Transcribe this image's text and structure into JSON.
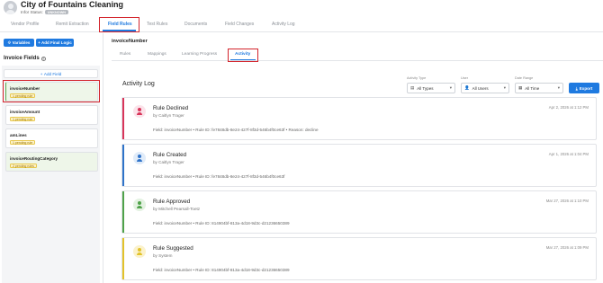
{
  "header": {
    "title": "City of Fountains Cleaning",
    "status_label": "Infor Status:",
    "status_badge": "UNKNOWN"
  },
  "top_tabs": [
    {
      "label": "Vendor Profile"
    },
    {
      "label": "Remit Extraction"
    },
    {
      "label": "Field Rules",
      "active": true
    },
    {
      "label": "Test Rules"
    },
    {
      "label": "Documents"
    },
    {
      "label": "Field Changes"
    },
    {
      "label": "Activity Log"
    }
  ],
  "left_panel": {
    "variables_label": "Variables",
    "add_final_logic_label": "+ Add Final Logic",
    "invoice_fields_label": "Invoice Fields",
    "help_glyph": "?",
    "add_field_label": "Add Field",
    "fields": [
      {
        "name": "invoiceNumber",
        "badge": "1 pending rule",
        "selected": true
      },
      {
        "name": "invoiceAmount",
        "badge": "1 pending rule"
      },
      {
        "name": "amLines",
        "badge": "1 pending rule"
      },
      {
        "name": "invoiceRoutingCategory",
        "badge": "2 pending rules"
      }
    ]
  },
  "main": {
    "section_title": "invoiceNumber",
    "sub_tabs": [
      {
        "label": "Rules"
      },
      {
        "label": "Mappings"
      },
      {
        "label": "Learning Progress"
      },
      {
        "label": "Activity",
        "active": true
      }
    ],
    "activity_log_title": "Activity Log",
    "filters": {
      "activity_type_label": "Activity Type",
      "activity_type_value": "All Types",
      "user_label": "User",
      "user_value": "All Users",
      "date_range_label": "Date Range",
      "date_range_value": "All Time",
      "export_label": "Export"
    },
    "activities": [
      {
        "title": "Rule Declined",
        "by": "by Caitlyn Trager",
        "date": "Apr 2, 2026 at 1:12 PM",
        "detail": "Field: invoiceNumber • Rule ID: fe7848db-8e24-427f-8f3d-546b4f0ce63f • Reason: decline",
        "color": "#d8355a",
        "icon_bg": "#fbe3ea"
      },
      {
        "title": "Rule Created",
        "by": "by Caitlyn Trager",
        "date": "Apr 1, 2026 at 1:04 PM",
        "detail": "Field: invoiceNumber • Rule ID: fe7848db-8e24-427f-8f3d-546b4f0ce63f",
        "color": "#2f73c9",
        "icon_bg": "#e1ecf9"
      },
      {
        "title": "Rule Approved",
        "by": "by Mitchell Pearsall-Toetz",
        "date": "Mar 27, 2026 at 1:10 PM",
        "detail": "Field: invoiceNumber • Rule ID: 814904bf-813a-4d18-9d3c-d21236650389",
        "color": "#4fa24a",
        "icon_bg": "#e4f2e2"
      },
      {
        "title": "Rule Suggested",
        "by": "by System",
        "date": "Mar 27, 2026 at 1:09 PM",
        "detail": "Field: invoiceNumber • Rule ID: 814904bf-813a-4d18-9d3c-d21236650389",
        "color": "#e2c22a",
        "icon_bg": "#fbf2cc"
      }
    ]
  },
  "colors": {
    "accent": "#1f7ae0",
    "highlight": "#d3242c"
  }
}
